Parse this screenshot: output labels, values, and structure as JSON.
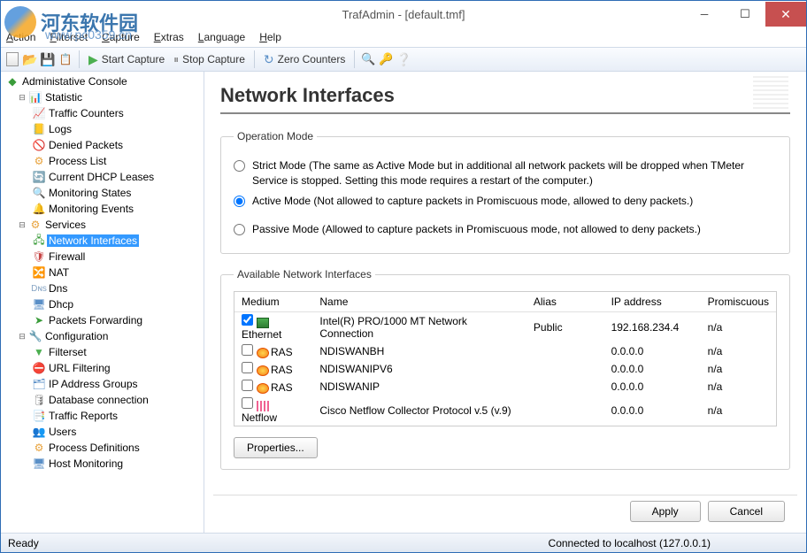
{
  "window": {
    "title": "TrafAdmin - [default.tmf]"
  },
  "watermark": {
    "text": "河东软件园",
    "url": "www.pc0359.cn"
  },
  "menu": {
    "items": [
      "Action",
      "Filterset",
      "Capture",
      "Extras",
      "Language",
      "Help"
    ]
  },
  "toolbar": {
    "start_capture": "Start Capture",
    "stop_capture": "Stop Capture",
    "zero_counters": "Zero Counters"
  },
  "tree": {
    "root": "Administative Console",
    "statistic": {
      "label": "Statistic",
      "items": [
        "Traffic Counters",
        "Logs",
        "Denied Packets",
        "Process List",
        "Current DHCP Leases",
        "Monitoring States",
        "Monitoring Events"
      ]
    },
    "services": {
      "label": "Services",
      "items": [
        "Network Interfaces",
        "Firewall",
        "NAT",
        "Dns",
        "Dhcp",
        "Packets Forwarding"
      ]
    },
    "configuration": {
      "label": "Configuration",
      "items": [
        "Filterset",
        "URL Filtering",
        "IP Address Groups",
        "Database connection",
        "Traffic Reports",
        "Users",
        "Process Definitions",
        "Host Monitoring"
      ]
    }
  },
  "page": {
    "title": "Network Interfaces",
    "operation_mode": {
      "legend": "Operation Mode",
      "strict": "Strict Mode (The same as Active Mode but in additional all network packets will be dropped when TMeter Service is stopped. Setting this mode requires a restart of the computer.)",
      "active": "Active Mode (Not allowed to capture packets in Promiscuous mode, allowed to deny packets.)",
      "passive": "Passive Mode (Allowed to capture packets in Promiscuous mode, not allowed to deny packets.)"
    },
    "interfaces": {
      "legend": "Available Network Interfaces",
      "columns": [
        "Medium",
        "Name",
        "Alias",
        "IP address",
        "Promiscuous"
      ],
      "rows": [
        {
          "checked": true,
          "icon": "eth",
          "medium": "Ethernet",
          "name": "Intel(R) PRO/1000 MT Network Connection",
          "alias": "Public",
          "ip": "192.168.234.4",
          "promisc": "n/a"
        },
        {
          "checked": false,
          "icon": "ras",
          "medium": "RAS",
          "name": "NDISWANBH",
          "alias": "",
          "ip": "0.0.0.0",
          "promisc": "n/a"
        },
        {
          "checked": false,
          "icon": "ras",
          "medium": "RAS",
          "name": "NDISWANIPV6",
          "alias": "",
          "ip": "0.0.0.0",
          "promisc": "n/a"
        },
        {
          "checked": false,
          "icon": "ras",
          "medium": "RAS",
          "name": "NDISWANIP",
          "alias": "",
          "ip": "0.0.0.0",
          "promisc": "n/a"
        },
        {
          "checked": false,
          "icon": "net",
          "medium": "Netflow",
          "name": "Cisco Netflow Collector Protocol v.5 (v.9)",
          "alias": "",
          "ip": "0.0.0.0",
          "promisc": "n/a"
        }
      ]
    },
    "properties_btn": "Properties...",
    "apply_btn": "Apply",
    "cancel_btn": "Cancel"
  },
  "status": {
    "left": "Ready",
    "right": "Connected to localhost (127.0.0.1)"
  }
}
